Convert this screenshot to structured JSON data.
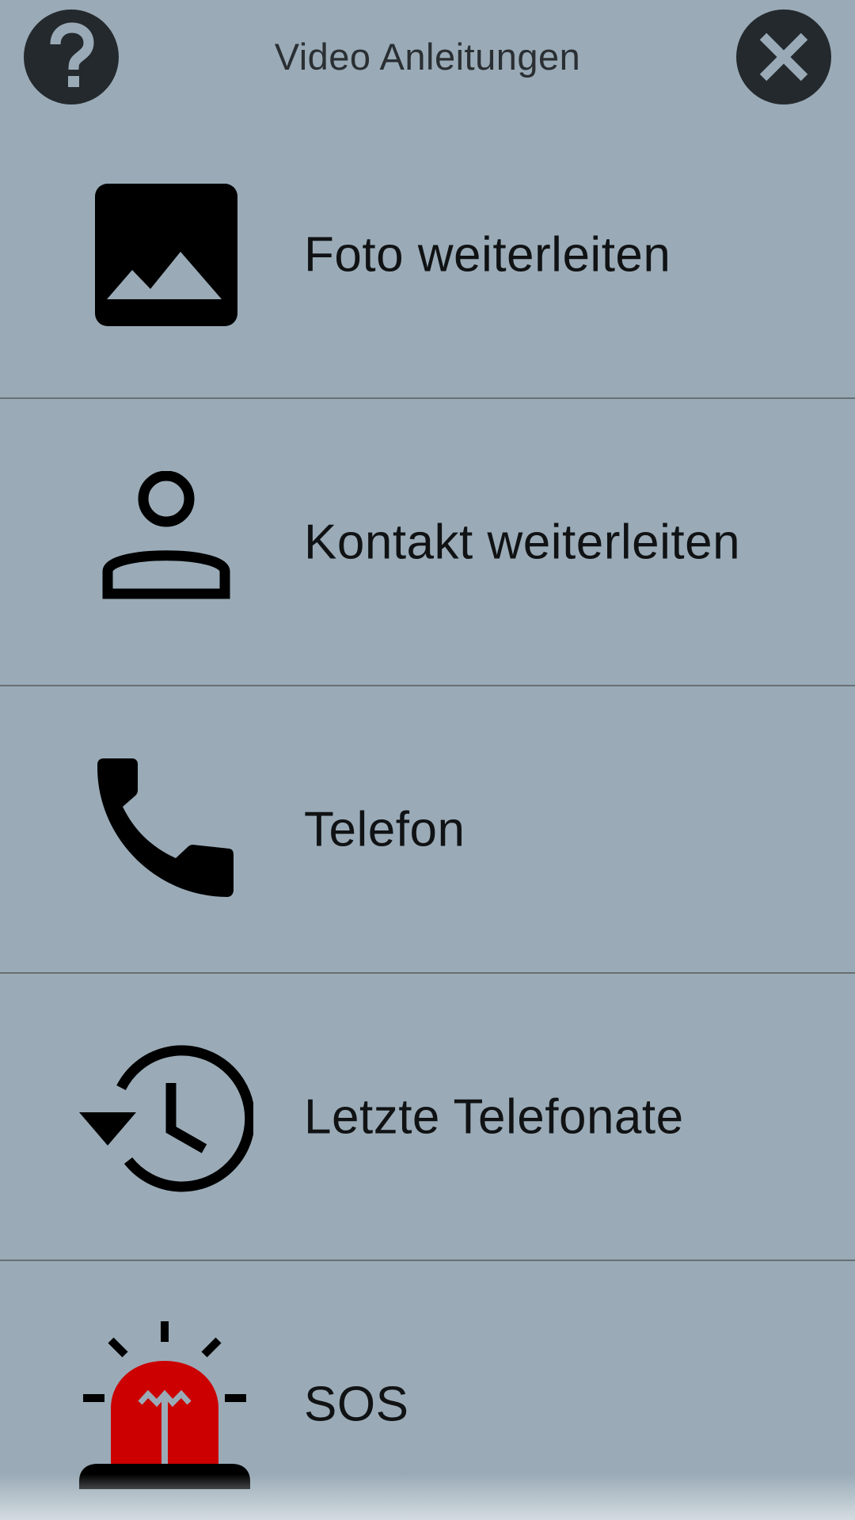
{
  "header": {
    "title": "Video Anleitungen",
    "help_icon": "question-mark-icon",
    "close_icon": "close-x-icon"
  },
  "items": [
    {
      "label": "Foto weiterleiten",
      "icon": "photo-icon"
    },
    {
      "label": "Kontakt weiterleiten",
      "icon": "person-icon"
    },
    {
      "label": "Telefon",
      "icon": "phone-icon"
    },
    {
      "label": "Letzte Telefonate",
      "icon": "history-icon"
    },
    {
      "label": "SOS",
      "icon": "sos-siren-icon"
    }
  ],
  "colors": {
    "background": "#9aabb7",
    "button_dark": "#24292d",
    "button_glyph": "#9aabb7",
    "divider": "#6a6f73",
    "text": "#101214",
    "sos_red": "#cc0000"
  }
}
